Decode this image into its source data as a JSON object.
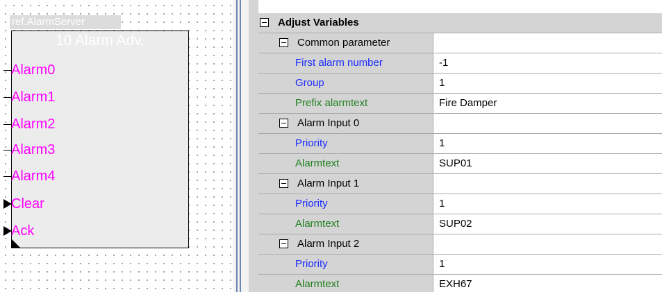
{
  "canvas": {
    "ref_label": "ref.AlarmServer",
    "block_title": "10 Alarm  Adv.",
    "pins": [
      {
        "label": "Alarm0",
        "type": "line"
      },
      {
        "label": "Alarm1",
        "type": "line"
      },
      {
        "label": "Alarm2",
        "type": "line"
      },
      {
        "label": "Alarm3",
        "type": "line"
      },
      {
        "label": "Alarm4",
        "type": "line"
      },
      {
        "label": "Clear",
        "type": "arrow"
      },
      {
        "label": "Ack",
        "type": "arrow"
      }
    ],
    "pin_color": "#ff00ff"
  },
  "grid": {
    "category": "Adjust Variables",
    "rows": [
      {
        "kind": "section",
        "name": "Common parameter",
        "value": ""
      },
      {
        "kind": "prop",
        "color": "blue",
        "name": "First alarm number",
        "value": "-1"
      },
      {
        "kind": "prop",
        "color": "blue",
        "name": "Group",
        "value": "1"
      },
      {
        "kind": "prop",
        "color": "green",
        "name": "Prefix alarmtext",
        "value": "Fire Damper"
      },
      {
        "kind": "section",
        "name": "Alarm Input 0",
        "value": ""
      },
      {
        "kind": "prop",
        "color": "blue",
        "name": "Priority",
        "value": "1"
      },
      {
        "kind": "prop",
        "color": "green",
        "name": "Alarmtext",
        "value": "SUP01"
      },
      {
        "kind": "section",
        "name": "Alarm Input 1",
        "value": ""
      },
      {
        "kind": "prop",
        "color": "blue",
        "name": "Priority",
        "value": "1"
      },
      {
        "kind": "prop",
        "color": "green",
        "name": "Alarmtext",
        "value": "SUP02"
      },
      {
        "kind": "section",
        "name": "Alarm Input 2",
        "value": ""
      },
      {
        "kind": "prop",
        "color": "blue",
        "name": "Priority",
        "value": "1"
      },
      {
        "kind": "prop",
        "color": "green",
        "name": "Alarmtext",
        "value": "EXH67"
      }
    ]
  }
}
